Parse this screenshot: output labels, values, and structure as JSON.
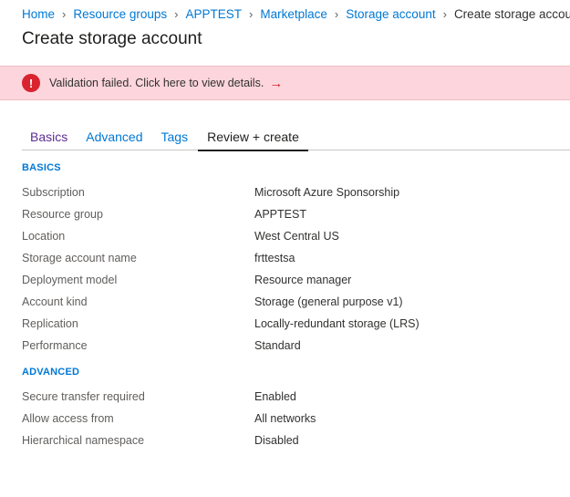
{
  "breadcrumb": [
    {
      "label": "Home"
    },
    {
      "label": "Resource groups"
    },
    {
      "label": "APPTEST"
    },
    {
      "label": "Marketplace"
    },
    {
      "label": "Storage account"
    }
  ],
  "breadcrumb_current": "Create storage account",
  "page_title": "Create storage account",
  "banner": {
    "text": "Validation failed. Click here to view details.",
    "icon": "error-icon",
    "arrow": "→",
    "color": "#d9232f"
  },
  "tabs": [
    {
      "label": "Basics"
    },
    {
      "label": "Advanced"
    },
    {
      "label": "Tags"
    },
    {
      "label": "Review + create"
    }
  ],
  "sections": {
    "basics": {
      "title": "BASICS",
      "rows": [
        {
          "label": "Subscription",
          "value": "Microsoft Azure Sponsorship"
        },
        {
          "label": "Resource group",
          "value": "APPTEST"
        },
        {
          "label": "Location",
          "value": "West Central US"
        },
        {
          "label": "Storage account name",
          "value": "frttestsa"
        },
        {
          "label": "Deployment model",
          "value": "Resource manager"
        },
        {
          "label": "Account kind",
          "value": "Storage (general purpose v1)"
        },
        {
          "label": "Replication",
          "value": "Locally-redundant storage (LRS)"
        },
        {
          "label": "Performance",
          "value": "Standard"
        }
      ]
    },
    "advanced": {
      "title": "ADVANCED",
      "rows": [
        {
          "label": "Secure transfer required",
          "value": "Enabled"
        },
        {
          "label": "Allow access from",
          "value": "All networks"
        },
        {
          "label": "Hierarchical namespace",
          "value": "Disabled"
        }
      ]
    }
  }
}
